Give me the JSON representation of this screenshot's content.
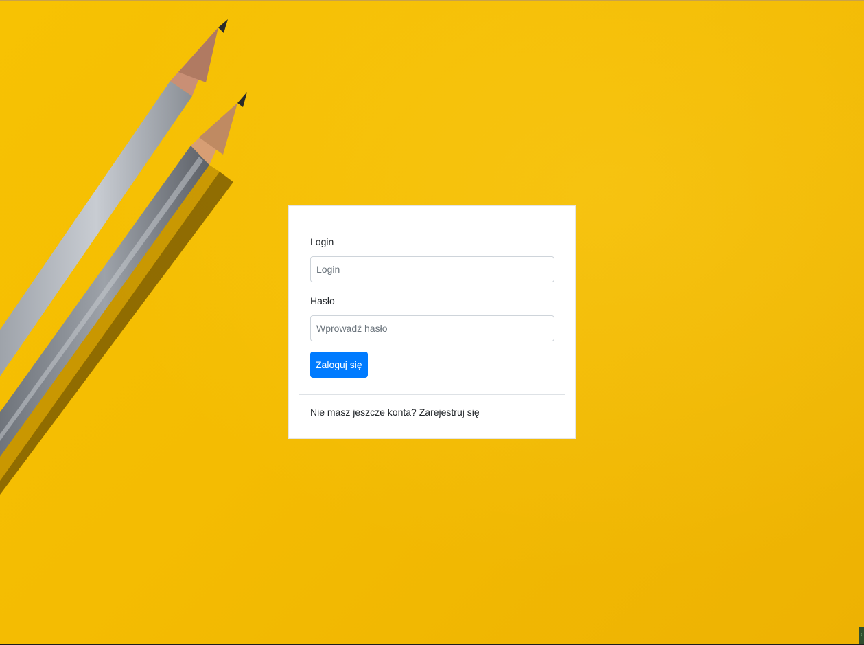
{
  "login_form": {
    "login_label": "Login",
    "login_placeholder": "Login",
    "password_label": "Hasło",
    "password_placeholder": "Wprowadź hasło",
    "submit_label": "Zaloguj się"
  },
  "footer": {
    "prompt": "Nie masz jeszcze konta?",
    "register_link": "Zarejestruj się"
  },
  "background": {
    "image": "two-pencils-on-yellow",
    "color": "#f4bc02"
  },
  "colors": {
    "primary": "#007bff"
  }
}
